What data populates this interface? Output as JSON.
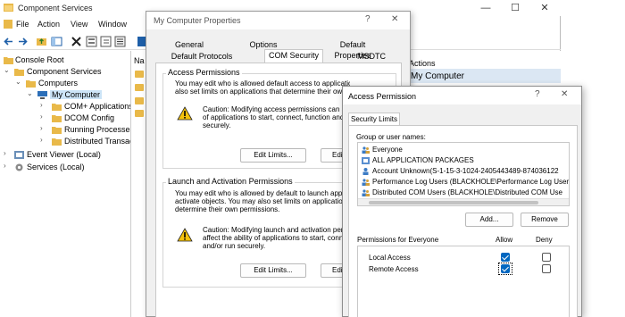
{
  "main_window": {
    "title": "Component Services",
    "menu": [
      "File",
      "Action",
      "View",
      "Window"
    ],
    "tree": {
      "items": [
        {
          "label": "Console Root",
          "level": 0
        },
        {
          "label": "Component Services",
          "level": 1
        },
        {
          "label": "Computers",
          "level": 2
        },
        {
          "label": "My Computer",
          "level": 3
        },
        {
          "label": "COM+ Applications",
          "level": 4
        },
        {
          "label": "DCOM Config",
          "level": 4
        },
        {
          "label": "Running Processes",
          "level": 4
        },
        {
          "label": "Distributed Transaction Coordinator",
          "level": 4
        },
        {
          "label": "Event Viewer (Local)",
          "level": 0
        },
        {
          "label": "Services (Local)",
          "level": 0
        }
      ]
    },
    "list_header": "Na",
    "actions": {
      "header": "Actions",
      "selected": "My Computer"
    }
  },
  "properties_dialog": {
    "title": "My Computer Properties",
    "tabs_row1": [
      "General",
      "Options",
      "Default Properties"
    ],
    "tabs_row2": [
      "Default Protocols",
      "COM Security",
      "MSDTC"
    ],
    "active_tab": "COM Security",
    "access": {
      "title": "Access Permissions",
      "text_line1": "You may edit who is allowed default access to applications. You may",
      "text_line2": "also set limits on applications that determine their own permissions.",
      "caution_line1": "Caution: Modifying access permissions can affect the ability",
      "caution_line2": "of applications to start, connect, function and/or run",
      "caution_line3": "securely.",
      "edit_limits": "Edit Limits...",
      "edit_default": "Edit Default..."
    },
    "launch": {
      "title": "Launch and Activation Permissions",
      "text_line1": "You may edit who is allowed by default to launch applications or",
      "text_line2": "activate objects. You may also set limits on applications that",
      "text_line3": "determine their own permissions.",
      "caution_line1": "Caution: Modifying launch and activation permissions can",
      "caution_line2": "affect the ability of applications to start, connect, function",
      "caution_line3": "and/or run securely.",
      "edit_limits": "Edit Limits...",
      "edit_default": "Edit Default..."
    }
  },
  "access_permission_dialog": {
    "title": "Access Permission",
    "tab": "Security Limits",
    "group_label": "Group or user names:",
    "users": [
      "Everyone",
      "ALL APPLICATION PACKAGES",
      "Account Unknown(S-1-15-3-1024-2405443489-874036122",
      "Performance Log Users (BLACKHOLE\\Performance Log Users",
      "Distributed COM Users (BLACKHOLE\\Distributed COM Use"
    ],
    "add_button": "Add...",
    "remove_button": "Remove",
    "permissions_for": "Permissions for Everyone",
    "col_allow": "Allow",
    "col_deny": "Deny",
    "permissions": [
      {
        "name": "Local Access",
        "allow": true,
        "deny": false
      },
      {
        "name": "Remote Access",
        "allow": true,
        "deny": false
      }
    ]
  }
}
